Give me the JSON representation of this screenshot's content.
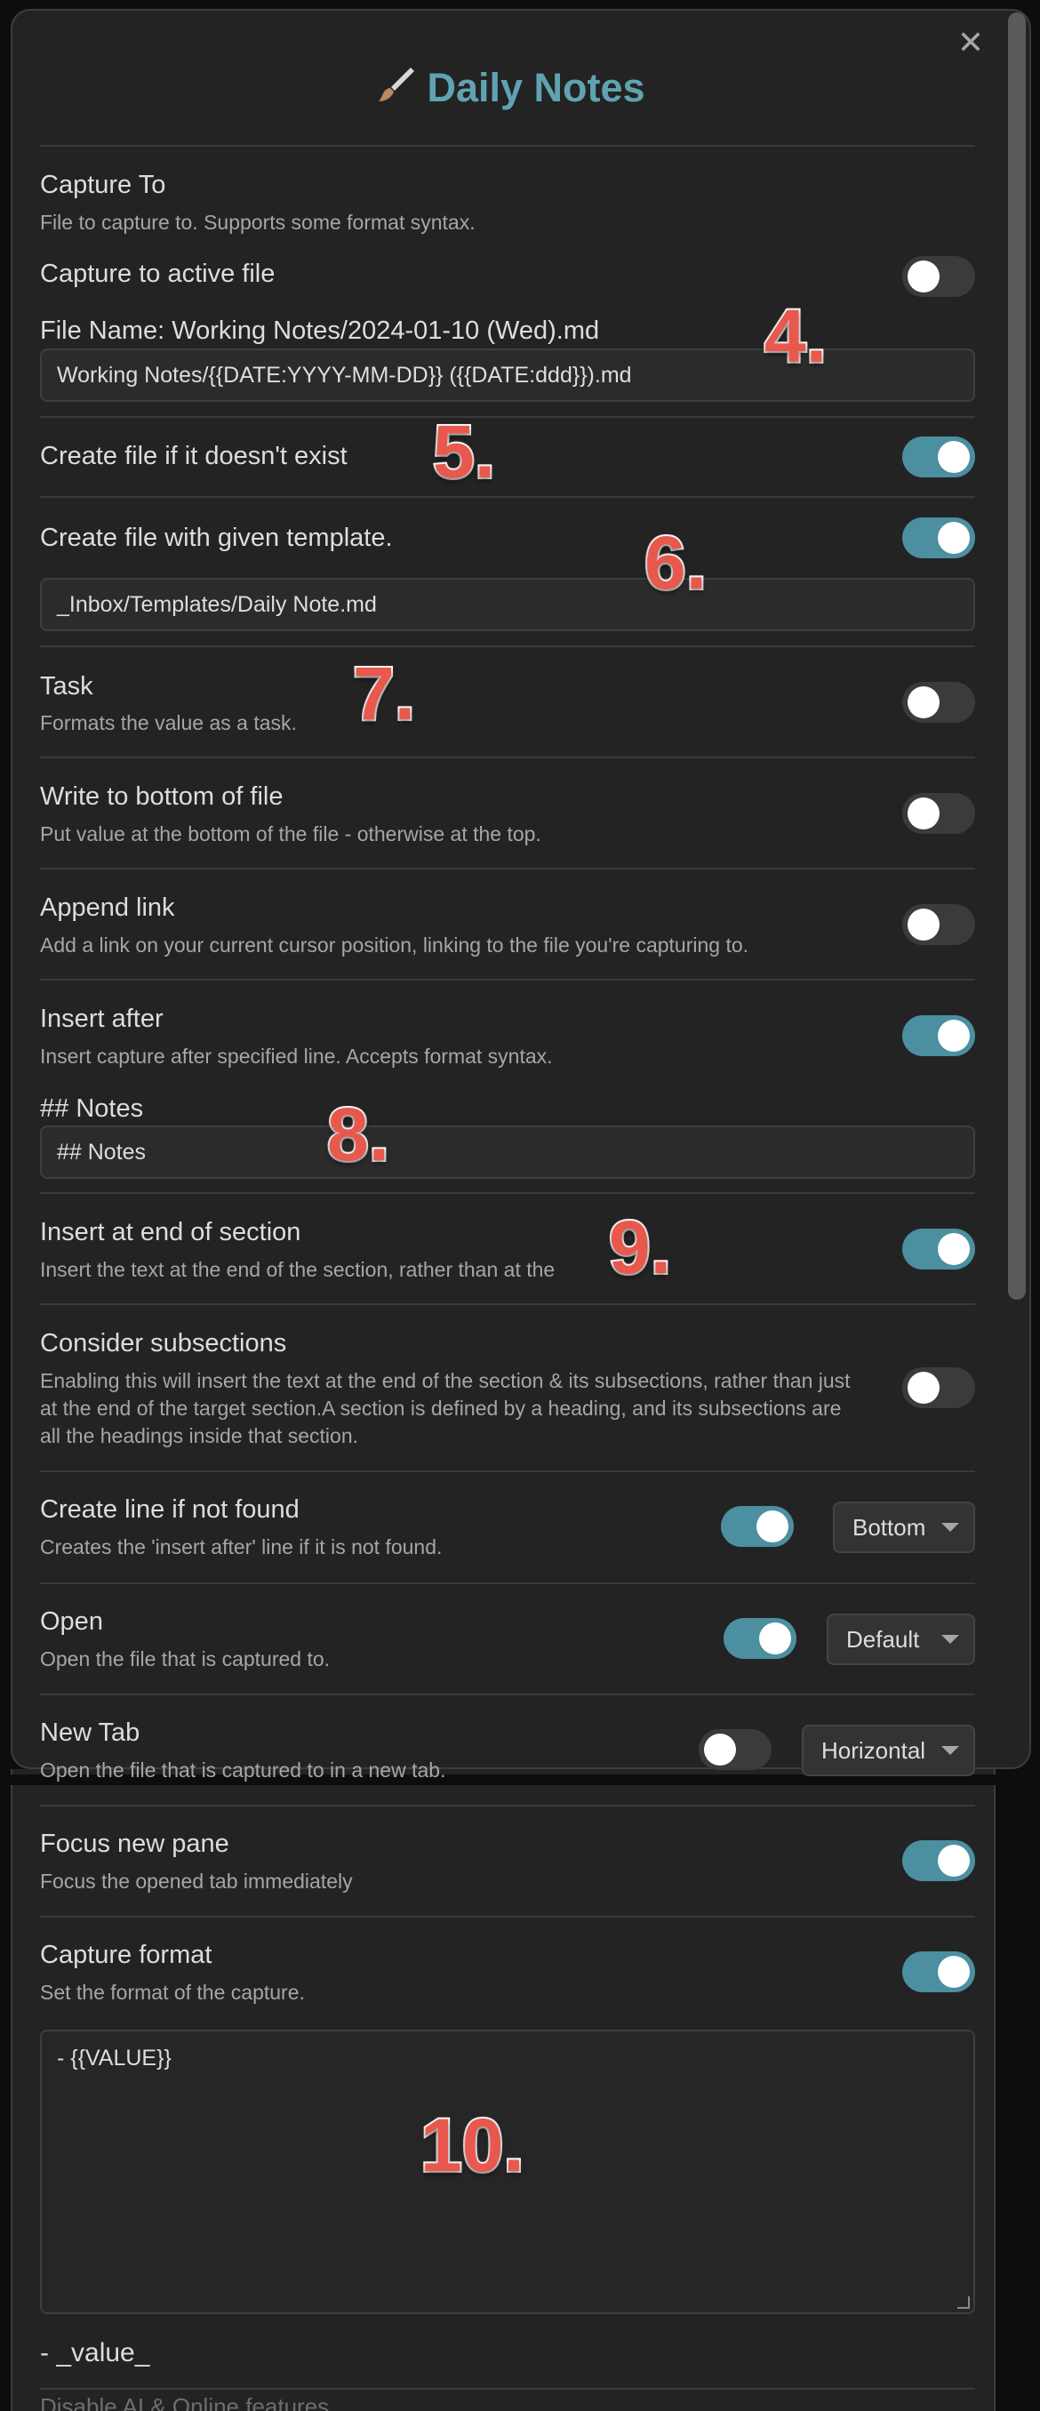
{
  "modal": {
    "title": "Daily Notes",
    "close_glyph": "✕",
    "title_icon": "paintbrush-icon"
  },
  "settings": {
    "capture_to": {
      "label": "Capture To",
      "desc": "File to capture to. Supports some format syntax."
    },
    "capture_active": {
      "label": "Capture to active file",
      "on": false
    },
    "file_name": {
      "label": "File Name: Working Notes/2024-01-10 (Wed).md",
      "value": "Working Notes/{{DATE:YYYY-MM-DD}} ({{DATE:ddd}}).md"
    },
    "create_if_missing": {
      "label": "Create file if it doesn't exist",
      "on": true
    },
    "create_with_template": {
      "label": "Create file with given template.",
      "on": true,
      "value": "_Inbox/Templates/Daily Note.md"
    },
    "task": {
      "label": "Task",
      "desc": "Formats the value as a task.",
      "on": false
    },
    "write_bottom": {
      "label": "Write to bottom of file",
      "desc": "Put value at the bottom of the file - otherwise at the top.",
      "on": false
    },
    "append_link": {
      "label": "Append link",
      "desc": "Add a link on your current cursor position, linking to the file you're capturing to.",
      "on": false
    },
    "insert_after": {
      "label": "Insert after",
      "desc": "Insert capture after specified line. Accepts format syntax.",
      "on": true,
      "sub_label": "## Notes",
      "value": "## Notes"
    },
    "insert_end_section": {
      "label": "Insert at end of section",
      "desc": "Insert the text at the end of the section, rather than at the",
      "on": true
    },
    "consider_subsections": {
      "label": "Consider subsections",
      "desc": "Enabling this will insert the text at the end of the section & its subsections, rather than just at the end of the target section.A section is defined by a heading, and its subsections are all the headings inside that section.",
      "on": false
    },
    "create_line": {
      "label": "Create line if not found",
      "desc": "Creates the 'insert after' line if it is not found.",
      "on": true,
      "select": "Bottom"
    },
    "open": {
      "label": "Open",
      "desc": "Open the file that is captured to.",
      "on": true,
      "select": "Default"
    },
    "new_tab": {
      "label": "New Tab",
      "desc": "Open the file that is captured to in a new tab.",
      "on": false,
      "select": "Horizontal"
    },
    "focus_pane": {
      "label": "Focus new pane",
      "desc": "Focus the opened tab immediately",
      "on": true
    },
    "capture_format": {
      "label": "Capture format",
      "desc": "Set the format of the capture.",
      "on": true,
      "value": "- {{VALUE}}"
    }
  },
  "preview": "- _value_",
  "cut_text": "Disable AI & Online features",
  "annotations": [
    "4.",
    "5.",
    "6.",
    "7.",
    "8.",
    "9.",
    "10."
  ],
  "colors": {
    "accent": "#5fa3b1",
    "toggle_on": "#4b8fa0",
    "annotation": "#e8584d"
  }
}
